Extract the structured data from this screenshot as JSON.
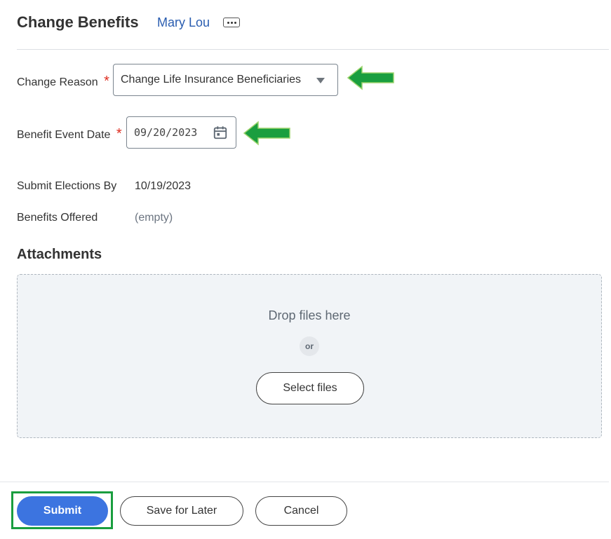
{
  "header": {
    "title": "Change Benefits",
    "worker_name": "Mary Lou",
    "more_icon": "ellipsis-icon"
  },
  "form": {
    "change_reason": {
      "label": "Change Reason",
      "required_marker": "*",
      "value": "Change Life Insurance Beneficiaries",
      "dropdown_icon": "caret-down-icon"
    },
    "benefit_event_date": {
      "label": "Benefit Event Date",
      "required_marker": "*",
      "value": "09/20/2023",
      "calendar_icon": "calendar-icon"
    },
    "submit_elections_by": {
      "label": "Submit Elections By",
      "value": "10/19/2023"
    },
    "benefits_offered": {
      "label": "Benefits Offered",
      "value": "(empty)"
    }
  },
  "attachments": {
    "title": "Attachments",
    "drop_text": "Drop files here",
    "or_text": "or",
    "select_files_label": "Select files"
  },
  "footer": {
    "submit_label": "Submit",
    "save_label": "Save for Later",
    "cancel_label": "Cancel"
  },
  "colors": {
    "link": "#2a5db0",
    "required": "#de2e21",
    "primary_button": "#3c74e0",
    "annotation_green": "#1a9e3f",
    "dropzone_bg": "#f1f4f7"
  }
}
